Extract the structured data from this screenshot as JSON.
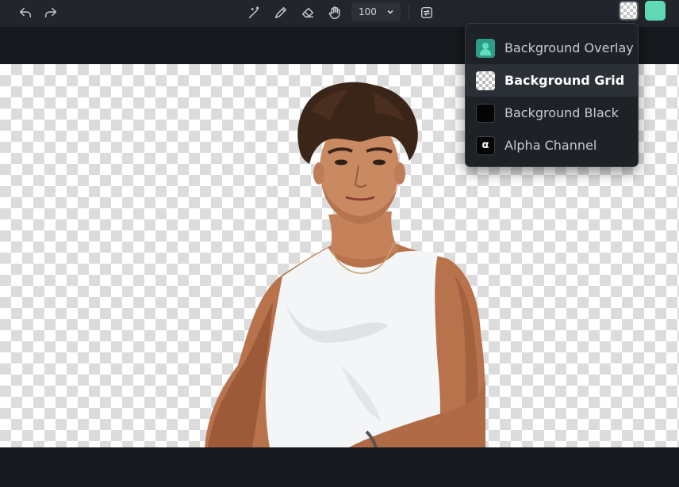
{
  "colors": {
    "accent": "#5fd9b3",
    "toolbar_bg": "#22262c",
    "menu_bg": "#1e2226",
    "active_item_bg": "#2b3036"
  },
  "toolbar": {
    "undo_icon": "undo-icon",
    "redo_icon": "redo-icon",
    "tools": [
      "magic-brush-icon",
      "brush-icon",
      "eraser-icon",
      "hand-icon"
    ],
    "zoom_value": "100",
    "compare_icon": "compare-icon",
    "background_toggle_icon": "checkerboard-icon"
  },
  "background_menu": {
    "items": [
      {
        "label": "Background Overlay",
        "icon": "person-icon",
        "active": false
      },
      {
        "label": "Background Grid",
        "icon": "checkerboard-icon",
        "active": true
      },
      {
        "label": "Background Black",
        "icon": "black-square-icon",
        "active": false
      },
      {
        "label": "Alpha Channel",
        "icon": "alpha-icon",
        "glyph": "α",
        "active": false
      }
    ]
  },
  "canvas": {
    "subject": "cutout of a young man in a white tank top",
    "background_mode": "Background Grid"
  }
}
